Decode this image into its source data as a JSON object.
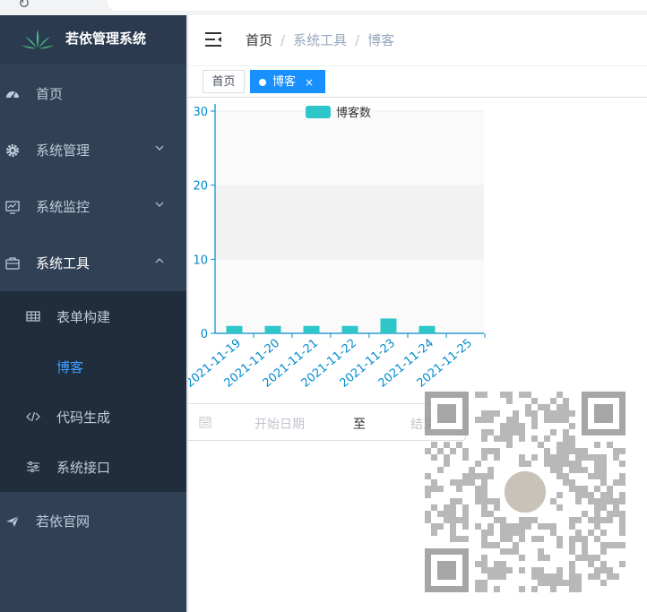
{
  "app": {
    "title": "若依管理系统"
  },
  "sidebar": {
    "items": [
      {
        "label": "首页",
        "icon": "dashboard-icon"
      },
      {
        "label": "系统管理",
        "icon": "gear-icon"
      },
      {
        "label": "系统监控",
        "icon": "monitor-icon"
      },
      {
        "label": "系统工具",
        "icon": "toolbox-icon"
      }
    ],
    "tools_sub": [
      {
        "label": "表单构建",
        "icon": "table-icon"
      },
      {
        "label": "博客",
        "icon": ""
      },
      {
        "label": "代码生成",
        "icon": "code-icon"
      },
      {
        "label": "系统接口",
        "icon": "sliders-icon"
      }
    ],
    "official": {
      "label": "若依官网",
      "icon": "paper-plane-icon"
    }
  },
  "breadcrumb": {
    "home": "首页",
    "sep": "/",
    "section": "系统工具",
    "page": "博客"
  },
  "tags": {
    "home": "首页",
    "active": "博客",
    "close": "×"
  },
  "date_range": {
    "start_placeholder": "开始日期",
    "separator": "至",
    "end_placeholder": "结束日期"
  },
  "colors": {
    "sidebar_bg": "#304156",
    "submenu_bg": "#1f2d3d",
    "accent": "#409eff",
    "tag_active": "#1890ff",
    "bar": "#2ec7c9",
    "axis": "#008acd"
  },
  "chart_data": {
    "type": "bar",
    "categories": [
      "2021-11-19",
      "2021-11-20",
      "2021-11-21",
      "2021-11-22",
      "2021-11-23",
      "2021-11-24",
      "2021-11-25"
    ],
    "series": [
      {
        "name": "博客数",
        "values": [
          1,
          1,
          1,
          1,
          2,
          1,
          0
        ]
      }
    ],
    "ylim": [
      0,
      30
    ],
    "yticks": [
      0,
      10,
      20,
      30
    ],
    "legend": "top-center",
    "grid": "horizontal bands"
  }
}
